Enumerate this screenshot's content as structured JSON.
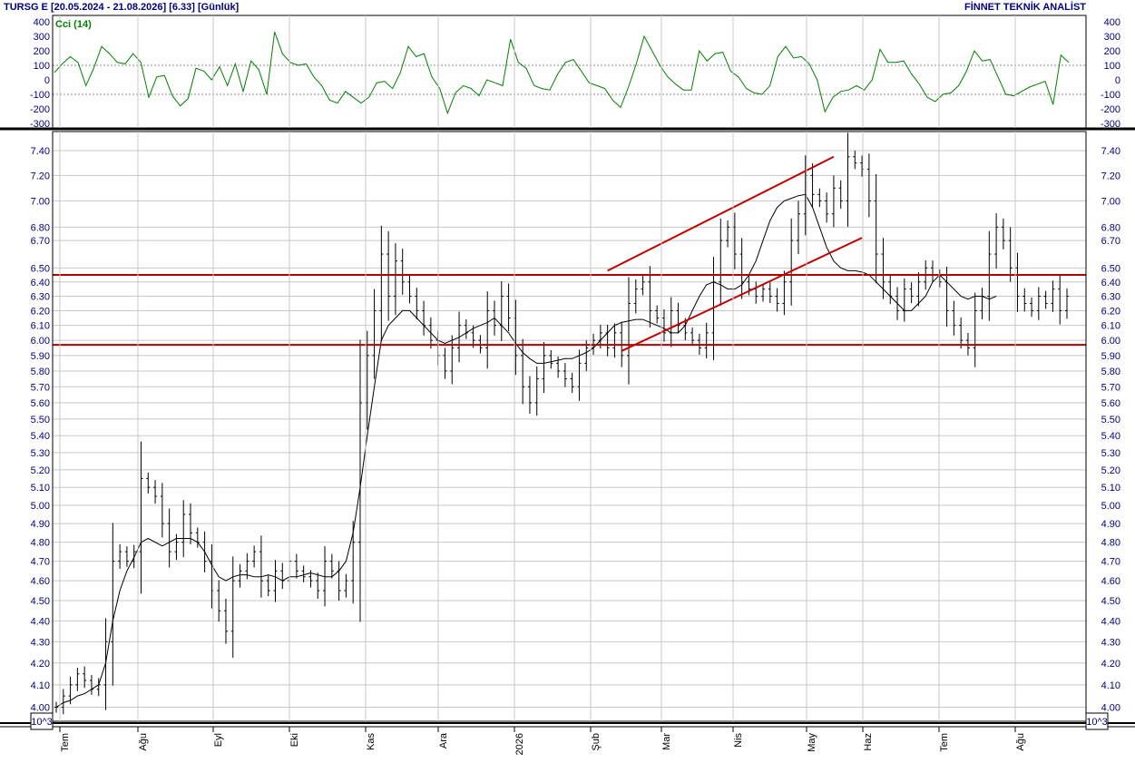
{
  "header": {
    "left": "TURSG E  [20.05.2024 - 21.08.2026]  [6.33]  [Günlük]",
    "right": "FİNNET TEKNİK ANALİST"
  },
  "chart_data": [
    {
      "type": "line",
      "title": "Cci (14)",
      "yticks": [
        "400",
        "300",
        "200",
        "100",
        "0",
        "-100",
        "-200",
        "-300"
      ],
      "ylim": [
        -300,
        400
      ],
      "grid": true,
      "series": [
        {
          "color": "#008000",
          "values": [
            50,
            110,
            160,
            120,
            -40,
            80,
            230,
            180,
            120,
            110,
            180,
            120,
            -120,
            20,
            30,
            -110,
            -180,
            -130,
            80,
            60,
            0,
            90,
            -40,
            110,
            -80,
            130,
            70,
            -100,
            330,
            180,
            120,
            100,
            110,
            20,
            -40,
            -140,
            -160,
            -80,
            -120,
            -160,
            -120,
            -20,
            -10,
            -60,
            50,
            230,
            160,
            180,
            20,
            -60,
            -230,
            -90,
            -40,
            -60,
            -110,
            0,
            -20,
            -40,
            280,
            120,
            80,
            -40,
            -60,
            -70,
            40,
            120,
            140,
            60,
            -20,
            -40,
            -60,
            -140,
            -190,
            -50,
            110,
            300,
            200,
            100,
            20,
            -30,
            -70,
            -70,
            200,
            130,
            180,
            190,
            60,
            20,
            -60,
            -90,
            -100,
            -40,
            160,
            230,
            150,
            160,
            110,
            0,
            -220,
            -120,
            -80,
            -70,
            -40,
            -70,
            0,
            210,
            120,
            120,
            130,
            40,
            -30,
            -120,
            -150,
            -100,
            -90,
            -40,
            60,
            200,
            130,
            140,
            20,
            -100,
            -110,
            -80,
            -50,
            -30,
            -10,
            -170,
            170,
            120
          ]
        }
      ]
    },
    {
      "type": "bar",
      "subtype": "ohlc",
      "yticks": [
        "7.40",
        "7.20",
        "7.00",
        "6.80",
        "6.70",
        "6.50",
        "6.40",
        "6.30",
        "6.20",
        "6.10",
        "6.00",
        "5.90",
        "5.80",
        "5.70",
        "5.60",
        "5.50",
        "5.40",
        "5.30",
        "5.20",
        "5.10",
        "5.00",
        "4.90",
        "4.80",
        "4.70",
        "4.60",
        "4.50",
        "4.40",
        "4.30",
        "4.20",
        "4.10",
        "4.00"
      ],
      "ylim": [
        3.95,
        7.55
      ],
      "log_scale": true,
      "x_axis_labels": [
        "Tem",
        "Ağu",
        "Eyl",
        "Eki",
        "Kas",
        "Ara",
        "2026",
        "Şub",
        "Mar",
        "Nis",
        "May",
        "Haz",
        "Tem",
        "Ağu"
      ],
      "volume_axis_label": "10^3",
      "close_values": [
        4.0,
        4.05,
        4.1,
        4.15,
        4.12,
        4.08,
        4.1,
        4.3,
        4.7,
        4.75,
        4.7,
        4.75,
        5.15,
        5.1,
        5.05,
        4.9,
        4.75,
        4.8,
        4.95,
        4.85,
        4.8,
        4.7,
        4.55,
        4.45,
        4.35,
        4.6,
        4.65,
        4.7,
        4.75,
        4.6,
        4.55,
        4.65,
        4.6,
        4.7,
        4.65,
        4.62,
        4.6,
        4.55,
        4.7,
        4.65,
        4.55,
        4.6,
        4.8,
        5.6,
        5.9,
        6.2,
        6.6,
        6.3,
        6.55,
        6.4,
        6.3,
        6.2,
        6.1,
        6.0,
        5.9,
        5.8,
        5.95,
        6.1,
        6.05,
        6.0,
        5.95,
        6.2,
        6.1,
        6.3,
        6.15,
        5.9,
        5.7,
        5.6,
        5.75,
        5.9,
        5.85,
        5.8,
        5.75,
        5.7,
        5.85,
        5.95,
        6.0,
        6.05,
        5.95,
        6.05,
        5.9,
        6.25,
        6.35,
        6.4,
        6.2,
        6.15,
        6.05,
        6.2,
        6.1,
        6.05,
        6.0,
        5.95,
        6.05,
        6.4,
        6.7,
        6.8,
        6.6,
        6.4,
        6.35,
        6.3,
        6.35,
        6.3,
        6.25,
        6.4,
        6.7,
        6.9,
        7.2,
        7.05,
        7.0,
        6.9,
        7.1,
        7.0,
        7.35,
        7.3,
        7.25,
        7.0,
        6.6,
        6.4,
        6.3,
        6.2,
        6.35,
        6.3,
        6.4,
        6.5,
        6.45,
        6.4,
        6.2,
        6.1,
        6.0,
        5.95,
        6.2,
        6.3,
        6.6,
        6.8,
        6.7,
        6.5,
        6.3,
        6.25,
        6.2,
        6.3,
        6.25,
        6.35,
        6.2,
        6.3
      ],
      "moving_average": [
        4.0,
        4.02,
        4.03,
        4.05,
        4.06,
        4.08,
        4.1,
        4.2,
        4.4,
        4.55,
        4.65,
        4.72,
        4.8,
        4.82,
        4.8,
        4.78,
        4.8,
        4.82,
        4.82,
        4.82,
        4.8,
        4.75,
        4.68,
        4.62,
        4.6,
        4.62,
        4.63,
        4.63,
        4.62,
        4.62,
        4.63,
        4.62,
        4.6,
        4.62,
        4.62,
        4.63,
        4.64,
        4.63,
        4.62,
        4.62,
        4.65,
        4.7,
        4.85,
        5.1,
        5.4,
        5.7,
        6.0,
        6.1,
        6.15,
        6.2,
        6.2,
        6.15,
        6.1,
        6.05,
        6.0,
        5.98,
        6.0,
        6.02,
        6.05,
        6.08,
        6.1,
        6.12,
        6.15,
        6.1,
        6.05,
        5.98,
        5.92,
        5.88,
        5.85,
        5.85,
        5.86,
        5.87,
        5.88,
        5.88,
        5.9,
        5.92,
        5.95,
        6.0,
        6.05,
        6.1,
        6.12,
        6.13,
        6.14,
        6.14,
        6.12,
        6.1,
        6.08,
        6.05,
        6.05,
        6.1,
        6.2,
        6.3,
        6.38,
        6.4,
        6.38,
        6.35,
        6.35,
        6.38,
        6.45,
        6.55,
        6.7,
        6.85,
        6.95,
        7.0,
        7.02,
        7.04,
        7.05,
        6.95,
        6.8,
        6.65,
        6.55,
        6.5,
        6.48,
        6.48,
        6.47,
        6.45,
        6.4,
        6.35,
        6.3,
        6.25,
        6.2,
        6.2,
        6.25,
        6.3,
        6.4,
        6.45,
        6.4,
        6.35,
        6.3,
        6.28,
        6.3,
        6.3,
        6.28,
        6.3
      ],
      "horizontal_lines": [
        6.45,
        5.97
      ],
      "trend_lines": [
        {
          "from": {
            "index": 78,
            "value": 6.48
          },
          "to": {
            "index": 110,
            "value": 7.35
          }
        },
        {
          "from": {
            "index": 80,
            "value": 5.93
          },
          "to": {
            "index": 114,
            "value": 6.72
          }
        }
      ]
    }
  ]
}
